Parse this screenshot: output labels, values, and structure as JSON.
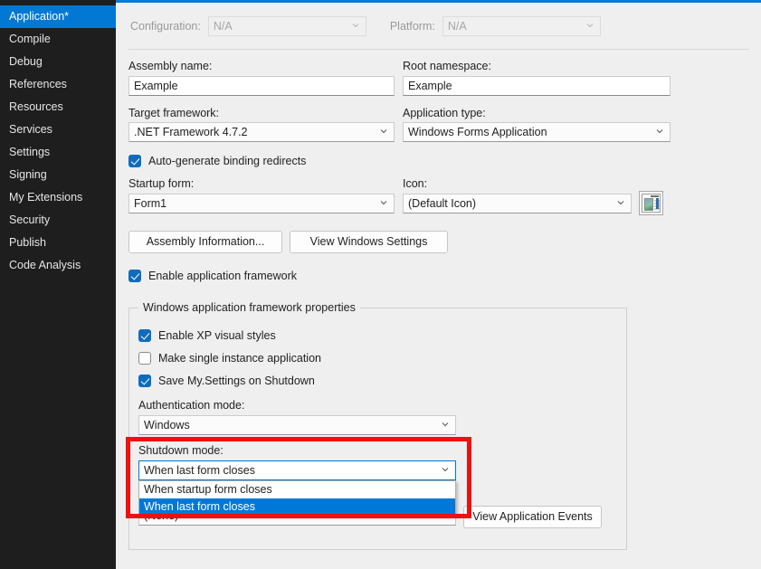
{
  "sidebar": {
    "items": [
      {
        "label": "Application*",
        "selected": true
      },
      {
        "label": "Compile",
        "selected": false
      },
      {
        "label": "Debug",
        "selected": false
      },
      {
        "label": "References",
        "selected": false
      },
      {
        "label": "Resources",
        "selected": false
      },
      {
        "label": "Services",
        "selected": false
      },
      {
        "label": "Settings",
        "selected": false
      },
      {
        "label": "Signing",
        "selected": false
      },
      {
        "label": "My Extensions",
        "selected": false
      },
      {
        "label": "Security",
        "selected": false
      },
      {
        "label": "Publish",
        "selected": false
      },
      {
        "label": "Code Analysis",
        "selected": false
      }
    ]
  },
  "header": {
    "configuration_label": "Configuration:",
    "configuration_value": "N/A",
    "platform_label": "Platform:",
    "platform_value": "N/A"
  },
  "general": {
    "assembly_name_label": "Assembly name:",
    "assembly_name_value": "Example",
    "root_namespace_label": "Root namespace:",
    "root_namespace_value": "Example",
    "target_framework_label": "Target framework:",
    "target_framework_value": ".NET Framework 4.7.2",
    "application_type_label": "Application type:",
    "application_type_value": "Windows Forms Application",
    "auto_generate_label": "Auto-generate binding redirects",
    "auto_generate_checked": true,
    "startup_form_label": "Startup form:",
    "startup_form_value": "Form1",
    "icon_label": "Icon:",
    "icon_value": "(Default Icon)",
    "assembly_information_button": "Assembly Information...",
    "view_windows_settings_button": "View Windows Settings"
  },
  "framework": {
    "enable_application_framework_label": "Enable application framework",
    "enable_application_framework_checked": true,
    "groupbox_title": "Windows application framework properties",
    "enable_xp_visual_styles_label": "Enable XP visual styles",
    "enable_xp_visual_styles_checked": true,
    "make_single_instance_label": "Make single instance application",
    "make_single_instance_checked": false,
    "save_my_settings_label": "Save My.Settings on Shutdown",
    "save_my_settings_checked": true,
    "authentication_mode_label": "Authentication mode:",
    "authentication_mode_value": "Windows",
    "shutdown_mode_label": "Shutdown mode:",
    "shutdown_mode_value": "When last form closes",
    "shutdown_mode_options": [
      {
        "label": "When startup form closes",
        "selected": false
      },
      {
        "label": "When last form closes",
        "selected": true
      }
    ],
    "splash_screen_value": "(None)",
    "view_application_events_button": "View Application Events"
  },
  "colors": {
    "accent": "#0078d4",
    "sidebar_bg": "#1e1e1e",
    "page_bg": "#efefef",
    "highlight_box": "#ee1111",
    "dropdown_selection": "#0078d7"
  }
}
